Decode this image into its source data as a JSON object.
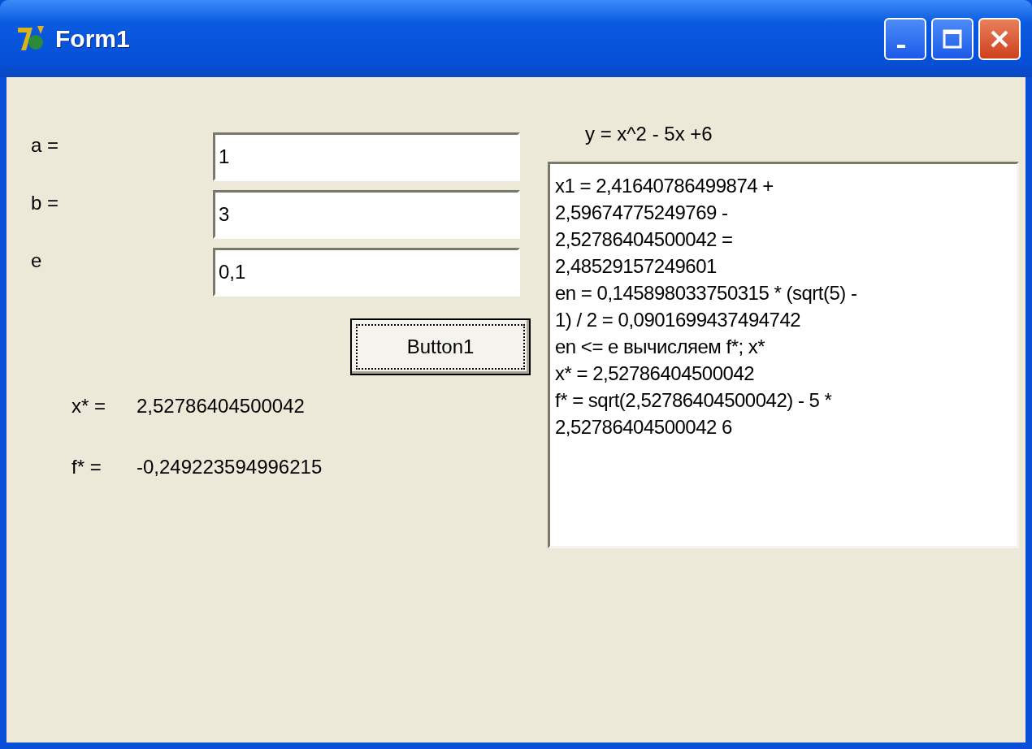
{
  "window": {
    "title": "Form1"
  },
  "fields": [
    {
      "label": "a =",
      "value": "1"
    },
    {
      "label": "b =",
      "value": "3"
    },
    {
      "label": "e",
      "value": "0,1"
    }
  ],
  "button": {
    "label": "Button1"
  },
  "results": [
    {
      "label": "x* =",
      "value": "2,52786404500042"
    },
    {
      "label": "f* =",
      "value": "-0,249223594996215"
    }
  ],
  "formula": "y = x^2 - 5x +6",
  "memo_lines": [
    "x1 = 2,41640786499874 +",
    "2,59674775249769 -",
    "2,52786404500042 =",
    "2,48529157249601",
    "en = 0,145898033750315 * (sqrt(5) -",
    "1) / 2 = 0,0901699437494742",
    "en <= e вычисляем f*; x*",
    "x* = 2,52786404500042",
    "f* = sqrt(2,52786404500042) - 5 *",
    "2,52786404500042 6"
  ]
}
